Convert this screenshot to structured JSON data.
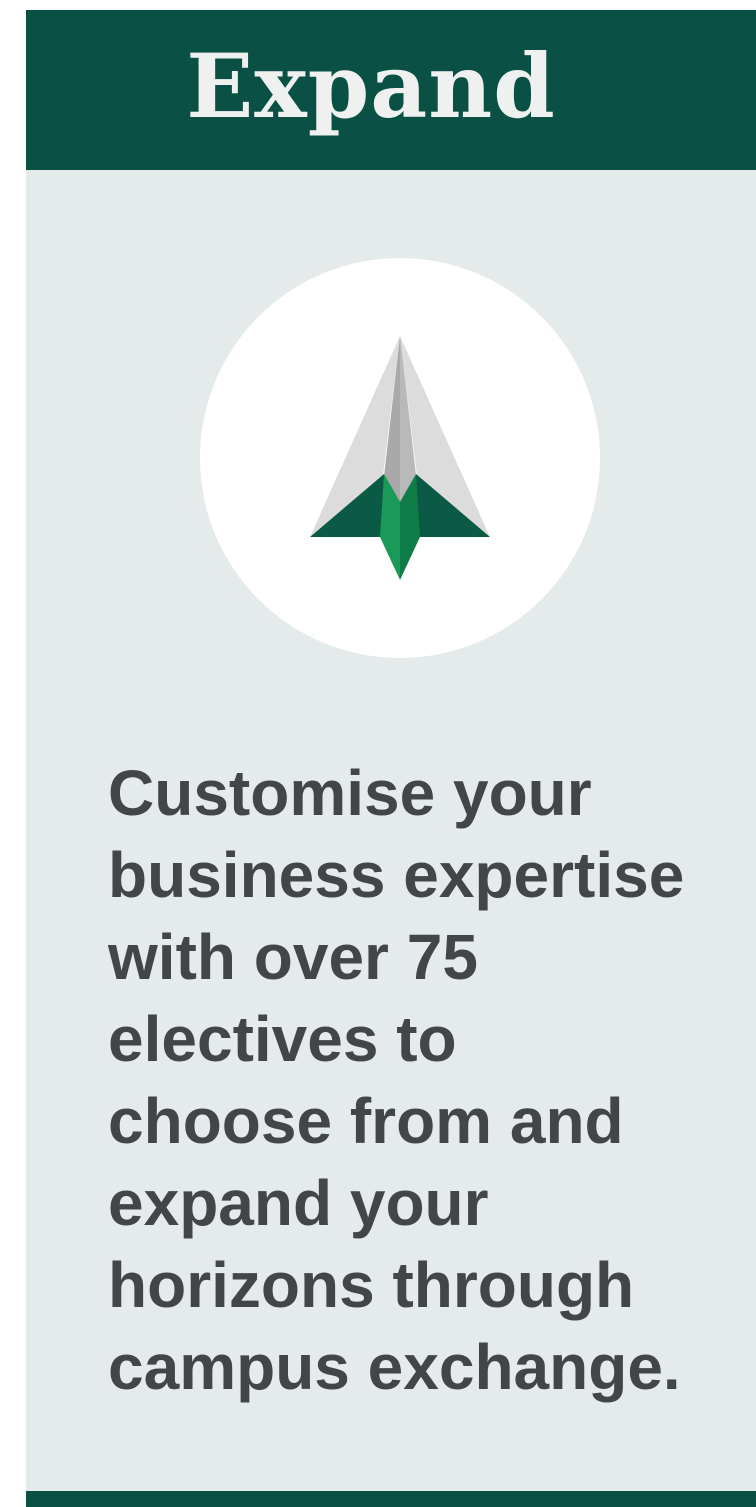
{
  "header": {
    "title": "Expand"
  },
  "icon": {
    "name": "paper-plane-icon"
  },
  "body": {
    "text": "Customise your\nbusiness expertise\nwith over 75\nelectives to\nchoose from and\nexpand your\nhorizons through\ncampus exchange."
  },
  "colors": {
    "header_bg": "#0b5044",
    "card_bg": "#e5ebeb",
    "text": "#424648",
    "accent_green": "#17925a"
  }
}
